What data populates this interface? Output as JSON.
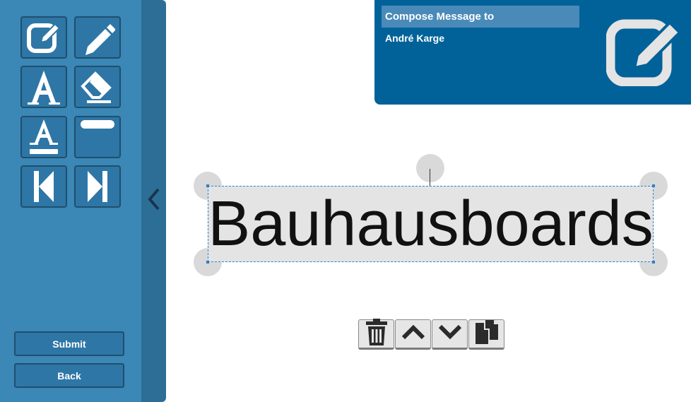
{
  "sidebar": {
    "tools": [
      {
        "name": "compose-tool",
        "icon": "edit-square-icon"
      },
      {
        "name": "pencil-tool",
        "icon": "pencil-icon"
      },
      {
        "name": "text-tool",
        "icon": "font-icon"
      },
      {
        "name": "eraser-tool",
        "icon": "eraser-icon"
      },
      {
        "name": "text-underline-tool",
        "icon": "font-underline-icon"
      },
      {
        "name": "rectangle-tool",
        "icon": "rectangle-icon"
      },
      {
        "name": "previous-page",
        "icon": "step-backward-icon"
      },
      {
        "name": "next-page",
        "icon": "step-forward-icon"
      }
    ],
    "submit_label": "Submit",
    "back_label": "Back",
    "collapse_icon": "chevron-left-icon"
  },
  "compose": {
    "title": "Compose Message to",
    "recipient": "André Karge",
    "icon": "edit-square-icon"
  },
  "canvas": {
    "text_element": "Bauhausboards"
  },
  "element_toolbar": {
    "buttons": [
      "trash-icon",
      "chevron-up-icon",
      "chevron-down-icon",
      "copy-icon"
    ]
  },
  "colors": {
    "sidebar": "#3b87b5",
    "sidebar_dark": "#2d6e97",
    "compose_panel": "#01629a",
    "selection": "#2f7fd0"
  }
}
